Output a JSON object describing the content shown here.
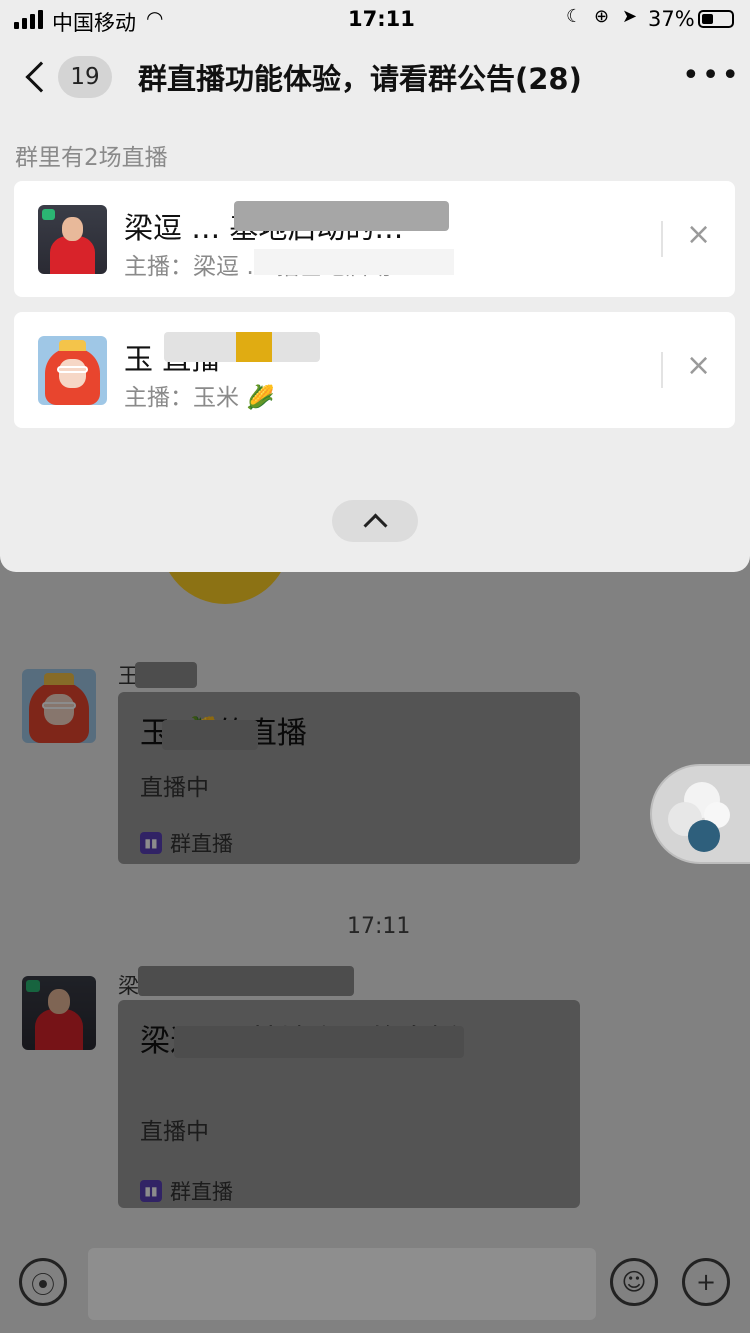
{
  "status_bar": {
    "carrier": "中国移动",
    "time": "17:11",
    "battery": "37%"
  },
  "nav": {
    "unread_count": "19",
    "title": "群直播功能体验，请看群公告(28)",
    "more": "•••"
  },
  "live_panel": {
    "section_label": "群里有2场直播",
    "items": [
      {
        "title_visible": "梁逗  …  基地启动的…",
        "host_prefix": "主播：",
        "host_visible": "梁逗  …  播基地启动",
        "close": "×"
      },
      {
        "title_visible": "玉      直播",
        "host_prefix": "主播：",
        "host_visible": "玉米  🌽",
        "close": "×"
      }
    ]
  },
  "messages": [
    {
      "sender": "王  🌽",
      "card_title": "玉   🌽的直播",
      "card_status": "直播中",
      "card_footer": "群直播"
    },
    {
      "timestamp": "17:11",
      "sender": "梁  基地启动",
      "card_title": "梁逗   …  基地启动的直播",
      "card_status": "直播中",
      "card_footer": "群直播"
    }
  ],
  "icons": {
    "back": "back-chevron-icon",
    "collapse": "chevron-up-icon",
    "voice": "voice-icon",
    "emoji": "emoji-icon",
    "add": "plus-icon",
    "live": "live-broadcast-icon"
  },
  "colors": {
    "panel_bg": "#ededed",
    "card_bg": "#ffffff",
    "live_badge": "#5a40b8",
    "overlay": "#7c7c7c"
  }
}
